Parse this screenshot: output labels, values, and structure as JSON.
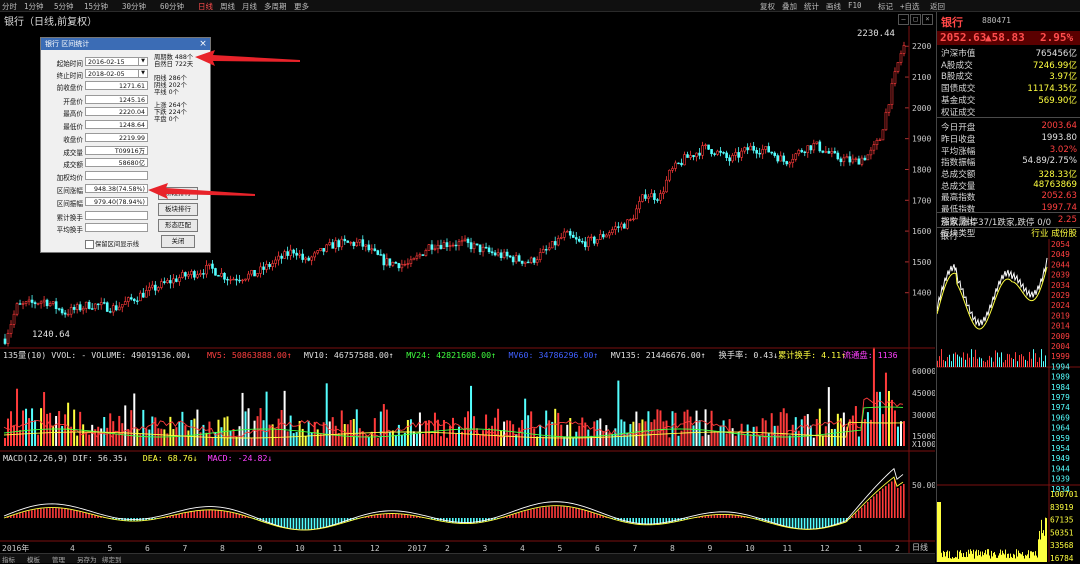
{
  "toolbar": {
    "periods": [
      "分时",
      "1分钟",
      "5分钟",
      "15分钟",
      "30分钟",
      "60分钟",
      "日线",
      "周线",
      "月线",
      "多周期",
      "更多"
    ],
    "active_period": "日线",
    "right_buttons": [
      "复权",
      "叠加",
      "统计",
      "画线",
      "F10",
      "标记",
      "+自选",
      "返回"
    ]
  },
  "chart_title": "银行（日线,前复权）",
  "price_axis": {
    "labels": [
      "2200",
      "2100",
      "2000",
      "1900",
      "1800",
      "1700",
      "1600",
      "1500",
      "1400"
    ],
    "max_label": "2230.44",
    "min_label": "1240.64"
  },
  "volume_panel": {
    "header": [
      {
        "text": "135量(10) VVOL: - VOLUME: 49019136.00↓",
        "color": "#e0e0e0"
      },
      {
        "text": "MV5: 50863888.00↑",
        "color": "#ff4040"
      },
      {
        "text": "MV10: 46757588.00↑",
        "color": "#e0e0e0"
      },
      {
        "text": "MV24: 42821608.00↑",
        "color": "#40ff40"
      },
      {
        "text": "MV60: 34786296.00↑",
        "color": "#4060ff"
      },
      {
        "text": "MV135: 21446676.00↑",
        "color": "#e0e0e0"
      },
      {
        "text": "换手率: 0.43↓",
        "color": "#e0e0e0"
      },
      {
        "text": "累计换手: 4.11↑",
        "color": "#ffff40"
      },
      {
        "text": "流通盘: 1136",
        "color": "#ff40ff"
      }
    ],
    "axis_labels": [
      "60000",
      "45000",
      "30000",
      "15000",
      "X1000"
    ]
  },
  "macd_panel": {
    "header": [
      {
        "text": "MACD(12,26,9) DIF: 56.35↓",
        "color": "#e0e0e0"
      },
      {
        "text": "DEA: 68.76↓",
        "color": "#ffff40"
      },
      {
        "text": "MACD: -24.82↓",
        "color": "#ff40ff"
      }
    ],
    "axis_labels": [
      "50.00",
      "0.00"
    ]
  },
  "x_axis": {
    "labels": [
      "2016年",
      "4",
      "5",
      "6",
      "7",
      "8",
      "9",
      "10",
      "11",
      "12",
      "2017",
      "2",
      "3",
      "4",
      "5",
      "6",
      "7",
      "8",
      "9",
      "10",
      "11",
      "12",
      "1",
      "2"
    ],
    "mode": "日线"
  },
  "bottom_tabs": [
    "指标",
    "模板",
    "管理",
    "另存为",
    "绑定到"
  ],
  "dialog": {
    "title": "银行 区间统计",
    "fields": [
      {
        "label": "起始时间",
        "value": "2016-02-15"
      },
      {
        "label": "终止时间",
        "value": "2018-02-05"
      },
      {
        "label": "前收盘价",
        "value": "1271.61"
      },
      {
        "label": "开盘价",
        "value": "1245.16"
      },
      {
        "label": "最高价",
        "value": "2220.04"
      },
      {
        "label": "最低价",
        "value": "1248.64"
      },
      {
        "label": "收盘价",
        "value": "2219.99"
      },
      {
        "label": "成交量",
        "value": "T09916万"
      },
      {
        "label": "成交额",
        "value": "58680亿"
      },
      {
        "label": "加权均价",
        "value": ""
      },
      {
        "label": "区间涨幅",
        "value": "948.38(74.58%)"
      },
      {
        "label": "区间振幅",
        "value": "979.40(78.94%)"
      },
      {
        "label": "累计换手",
        "value": ""
      },
      {
        "label": "平均换手",
        "value": ""
      }
    ],
    "stats": [
      "周期数 488个",
      "自然日 722天",
      "阳线 286个",
      "阴线 202个",
      "平线 0个",
      "上涨 264个",
      "下跌 224个",
      "平盘 0个"
    ],
    "buttons": [
      "阶段排行",
      "板块排行",
      "形态匹配",
      "关闭"
    ],
    "checkbox_label": "保留区间显示线"
  },
  "right_panel": {
    "name": "银行",
    "code": "880471",
    "price": "2052.63",
    "change": "▲58.83",
    "pct": "2.95%",
    "rows": [
      {
        "label": "沪深市值",
        "value": "765456亿",
        "color": "#e0e0e0"
      },
      {
        "label": "A股成交",
        "value": "7246.99亿",
        "color": "#ffff40"
      },
      {
        "label": "B股成交",
        "value": "3.97亿",
        "color": "#ffff40"
      },
      {
        "label": "国债成交",
        "value": "11174.35亿",
        "color": "#ffff40"
      },
      {
        "label": "基金成交",
        "value": "569.90亿",
        "color": "#ffff40"
      },
      {
        "label": "权证成交",
        "value": "",
        "color": "#ffff40"
      },
      {
        "label": "今日开盘",
        "value": "2003.64",
        "color": "#ff4040"
      },
      {
        "label": "昨日收盘",
        "value": "1993.80",
        "color": "#e0e0e0"
      },
      {
        "label": "平均涨幅",
        "value": "3.02%",
        "color": "#ff4040"
      },
      {
        "label": "指数振幅",
        "value": "54.89/2.75%",
        "color": "#e0e0e0"
      },
      {
        "label": "总成交额",
        "value": "328.33亿",
        "color": "#ffff40"
      },
      {
        "label": "总成交量",
        "value": "48763869",
        "color": "#ffff40"
      },
      {
        "label": "最高指数",
        "value": "2052.63",
        "color": "#ff4040"
      },
      {
        "label": "最低指数",
        "value": "1997.74",
        "color": "#ff4040"
      },
      {
        "label": "指数量比",
        "value": "2.25",
        "color": "#ff4040"
      },
      {
        "label": "板块类型",
        "value": "行业  成份股",
        "color": "#ffff40"
      }
    ],
    "breadth": "涨家,涨停37/1跌家,跌停 0/0",
    "mini_title": "银行",
    "mini_price_labels": [
      "2054",
      "2049",
      "2044",
      "2039",
      "2034",
      "2029",
      "2024",
      "2019",
      "2014",
      "2009",
      "2004",
      "1999",
      "1994",
      "1989",
      "1984",
      "1979",
      "1974",
      "1969",
      "1964",
      "1959",
      "1954",
      "1949",
      "1944",
      "1939",
      "1934"
    ],
    "mini_vol_labels": [
      "100701",
      "83919",
      "67135",
      "50351",
      "33568",
      "16784"
    ]
  }
}
